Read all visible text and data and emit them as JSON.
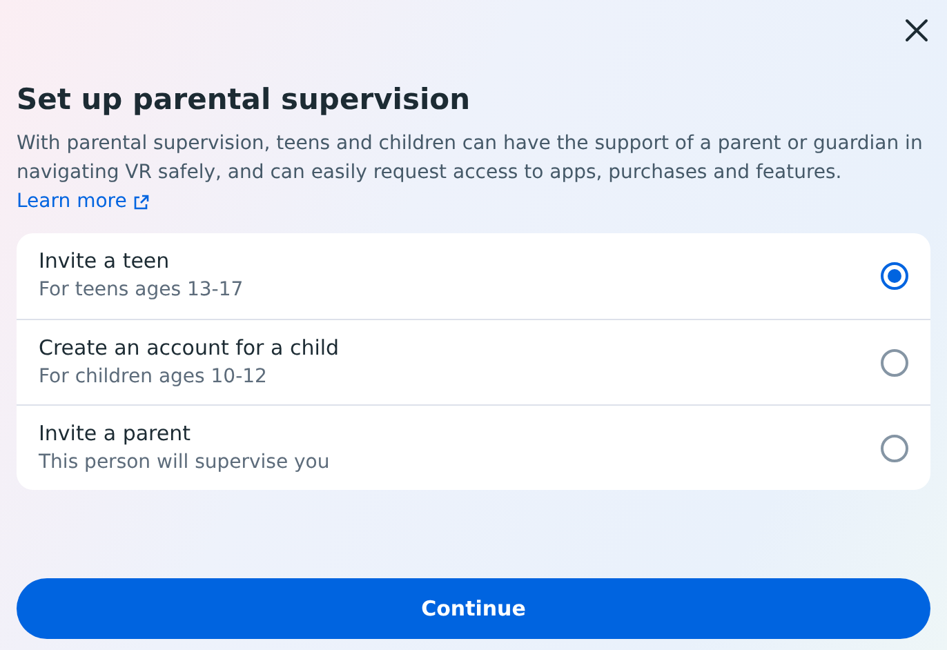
{
  "dialog": {
    "title": "Set up parental supervision",
    "description": "With parental supervision, teens and children can have the support of a parent or guardian in navigating VR safely, and can easily request access to apps, purchases and features.",
    "link": "Learn more"
  },
  "options": [
    {
      "label": "Invite a teen",
      "sublabel": "For teens ages 13-17",
      "selected": true
    },
    {
      "label": "Create an account for a child",
      "sublabel": "For children ages 10-12",
      "selected": false
    },
    {
      "label": "Invite a parent",
      "sublabel": "This person will supervise you",
      "selected": false
    }
  ],
  "button": "Continue"
}
